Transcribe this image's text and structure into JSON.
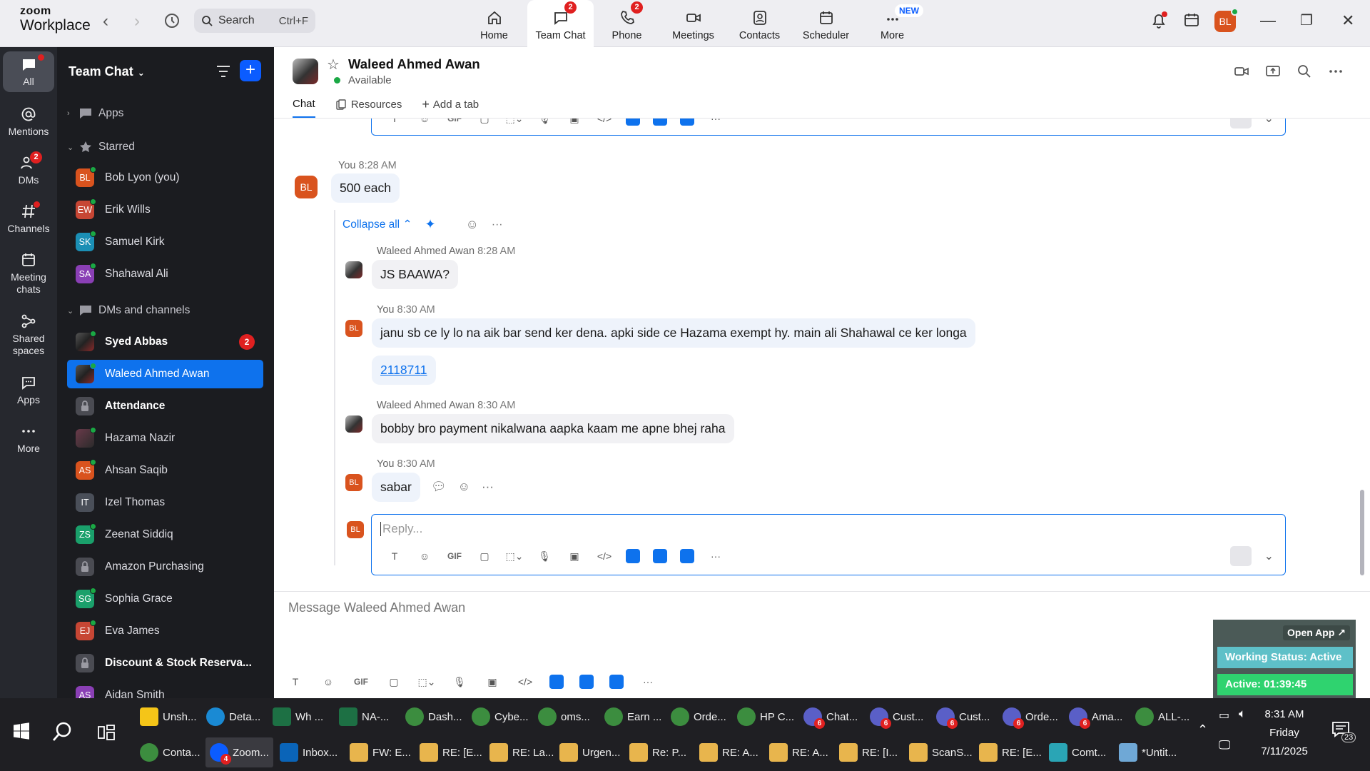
{
  "app": {
    "logo_line1": "zoom",
    "logo_line2": "Workplace"
  },
  "search": {
    "placeholder": "Search",
    "shortcut": "Ctrl+F"
  },
  "topnav": [
    {
      "label": "Home",
      "icon": "home-icon",
      "badge": ""
    },
    {
      "label": "Team Chat",
      "icon": "chat-icon",
      "badge": "2",
      "active": true
    },
    {
      "label": "Phone",
      "icon": "phone-icon",
      "badge": "2"
    },
    {
      "label": "Meetings",
      "icon": "video-icon",
      "badge": ""
    },
    {
      "label": "Contacts",
      "icon": "contacts-icon",
      "badge": ""
    },
    {
      "label": "Scheduler",
      "icon": "calendar-icon",
      "badge": ""
    },
    {
      "label": "More",
      "icon": "more-icon",
      "badge": "NEW"
    }
  ],
  "user": {
    "initials": "BL",
    "color": "#d9531e"
  },
  "rail": [
    {
      "label": "All",
      "icon": "chat-bubble-icon",
      "active": true
    },
    {
      "label": "Mentions",
      "icon": "at-icon"
    },
    {
      "label": "DMs",
      "icon": "people-icon",
      "badge": "2"
    },
    {
      "label": "Channels",
      "icon": "hash-icon"
    },
    {
      "label": "Meeting chats",
      "icon": "calendar-icon"
    },
    {
      "label": "Shared spaces",
      "icon": "share-icon"
    },
    {
      "label": "Apps",
      "icon": "apps-icon"
    },
    {
      "label": "More",
      "icon": "more-icon"
    }
  ],
  "sidebar": {
    "title": "Team Chat",
    "sections": {
      "apps": "Apps",
      "starred": "Starred",
      "dms": "DMs and channels"
    },
    "starred": [
      {
        "initials": "BL",
        "name": "Bob Lyon (you)",
        "color": "#d9531e"
      },
      {
        "initials": "EW",
        "name": "Erik Wills",
        "color": "#c74634"
      },
      {
        "initials": "SK",
        "name": "Samuel Kirk",
        "color": "#1b8fb5"
      },
      {
        "initials": "SA",
        "name": "Shahawal Ali",
        "color": "#8a3fb5"
      }
    ],
    "dms": [
      {
        "initials": "",
        "name": "Syed Abbas",
        "type": "photo",
        "bold": true,
        "count": "2"
      },
      {
        "initials": "",
        "name": "Waleed Ahmed Awan",
        "type": "photo",
        "selected": true
      },
      {
        "initials": "",
        "name": "Attendance",
        "type": "lock",
        "bold": true
      },
      {
        "initials": "",
        "name": "Hazama Nazir",
        "type": "photo2"
      },
      {
        "initials": "AS",
        "name": "Ahsan Saqib",
        "color": "#d9531e"
      },
      {
        "initials": "IT",
        "name": "Izel Thomas",
        "color": "#4a4f59"
      },
      {
        "initials": "ZS",
        "name": "Zeenat Siddiq",
        "color": "#1aa06b"
      },
      {
        "initials": "",
        "name": "Amazon Purchasing",
        "type": "lock"
      },
      {
        "initials": "SG",
        "name": "Sophia Grace",
        "color": "#1aa06b"
      },
      {
        "initials": "EJ",
        "name": "Eva James",
        "color": "#c74634"
      },
      {
        "initials": "",
        "name": "Discount & Stock Reserva...",
        "type": "lock",
        "bold": true
      },
      {
        "initials": "AS",
        "name": "Aidan Smith",
        "color": "#8a3fb5"
      }
    ]
  },
  "chat": {
    "name": "Waleed Ahmed Awan",
    "status": "Available",
    "tabs": [
      "Chat",
      "Resources",
      "Add a tab"
    ],
    "collapse_label": "Collapse all",
    "messages": [
      {
        "sender": "You",
        "time": "8:28 AM",
        "text": "500 each"
      },
      {
        "sender": "Waleed Ahmed Awan",
        "time": "8:28 AM",
        "text": "JS BAAWA?"
      },
      {
        "sender": "You",
        "time": "8:30 AM",
        "text": "janu sb ce ly lo na aik bar send ker dena. apki side ce Hazama exempt hy. main ali Shahawal ce ker longa",
        "link": "2118711"
      },
      {
        "sender": "Waleed Ahmed Awan",
        "time": "8:30 AM",
        "text": "bobby bro payment nikalwana aapka kaam me apne bhej raha"
      },
      {
        "sender": "You",
        "time": "8:30 AM",
        "text": "sabar"
      }
    ],
    "reply_placeholder": "Reply...",
    "message_placeholder": "Message Waleed Ahmed Awan",
    "gif_label": "GIF"
  },
  "widget": {
    "open_label": "Open App ↗",
    "working_status": "Working Status: Active",
    "active_time": "Active: 01:39:45"
  },
  "taskbar": {
    "row1": [
      {
        "label": "Unsh...",
        "color": "#f5c518",
        "shape": "sq"
      },
      {
        "label": "Deta...",
        "color": "#1a8ad4"
      },
      {
        "label": "Wh ...",
        "color": "#1d7044",
        "shape": "sq"
      },
      {
        "label": "NA-...",
        "color": "#1d7044",
        "shape": "sq"
      },
      {
        "label": "Dash...",
        "color": "#3c8d3f"
      },
      {
        "label": "Cybe...",
        "color": "#3c8d3f"
      },
      {
        "label": "oms...",
        "color": "#3c8d3f"
      },
      {
        "label": "Earn ...",
        "color": "#3c8d3f"
      },
      {
        "label": "Orde...",
        "color": "#3c8d3f"
      },
      {
        "label": "HP C...",
        "color": "#3c8d3f"
      },
      {
        "label": "Chat...",
        "color": "#5a5fc7",
        "badge": "6"
      },
      {
        "label": "Cust...",
        "color": "#5a5fc7",
        "badge": "6"
      },
      {
        "label": "Cust...",
        "color": "#5a5fc7",
        "badge": "6"
      },
      {
        "label": "Orde...",
        "color": "#5a5fc7",
        "badge": "6"
      },
      {
        "label": "Ama...",
        "color": "#5a5fc7",
        "badge": "6"
      },
      {
        "label": "ALL-...",
        "color": "#3c8d3f"
      }
    ],
    "row2": [
      {
        "label": "Conta...",
        "color": "#3c8d3f"
      },
      {
        "label": "Zoom...",
        "color": "#0b5cff",
        "badge": "4",
        "active": true
      },
      {
        "label": "Inbox...",
        "color": "#0a64b8",
        "shape": "sq"
      },
      {
        "label": "FW: E...",
        "color": "#e8b54d",
        "shape": "sq"
      },
      {
        "label": "RE: [E...",
        "color": "#e8b54d",
        "shape": "sq"
      },
      {
        "label": "RE: La...",
        "color": "#e8b54d",
        "shape": "sq"
      },
      {
        "label": "Urgen...",
        "color": "#e8b54d",
        "shape": "sq"
      },
      {
        "label": "Re: P...",
        "color": "#e8b54d",
        "shape": "sq"
      },
      {
        "label": "RE: A...",
        "color": "#e8b54d",
        "shape": "sq"
      },
      {
        "label": "RE: A...",
        "color": "#e8b54d",
        "shape": "sq"
      },
      {
        "label": "RE: [I...",
        "color": "#e8b54d",
        "shape": "sq"
      },
      {
        "label": "ScanS...",
        "color": "#e8b54d",
        "shape": "sq"
      },
      {
        "label": "RE: [E...",
        "color": "#e8b54d",
        "shape": "sq"
      },
      {
        "label": "Comt...",
        "color": "#2aa5b5",
        "shape": "sq"
      },
      {
        "label": "*Untit...",
        "color": "#6fa8d6",
        "shape": "sq"
      }
    ],
    "time": "8:31 AM",
    "day": "Friday",
    "date": "7/11/2025",
    "notifications": "23"
  }
}
